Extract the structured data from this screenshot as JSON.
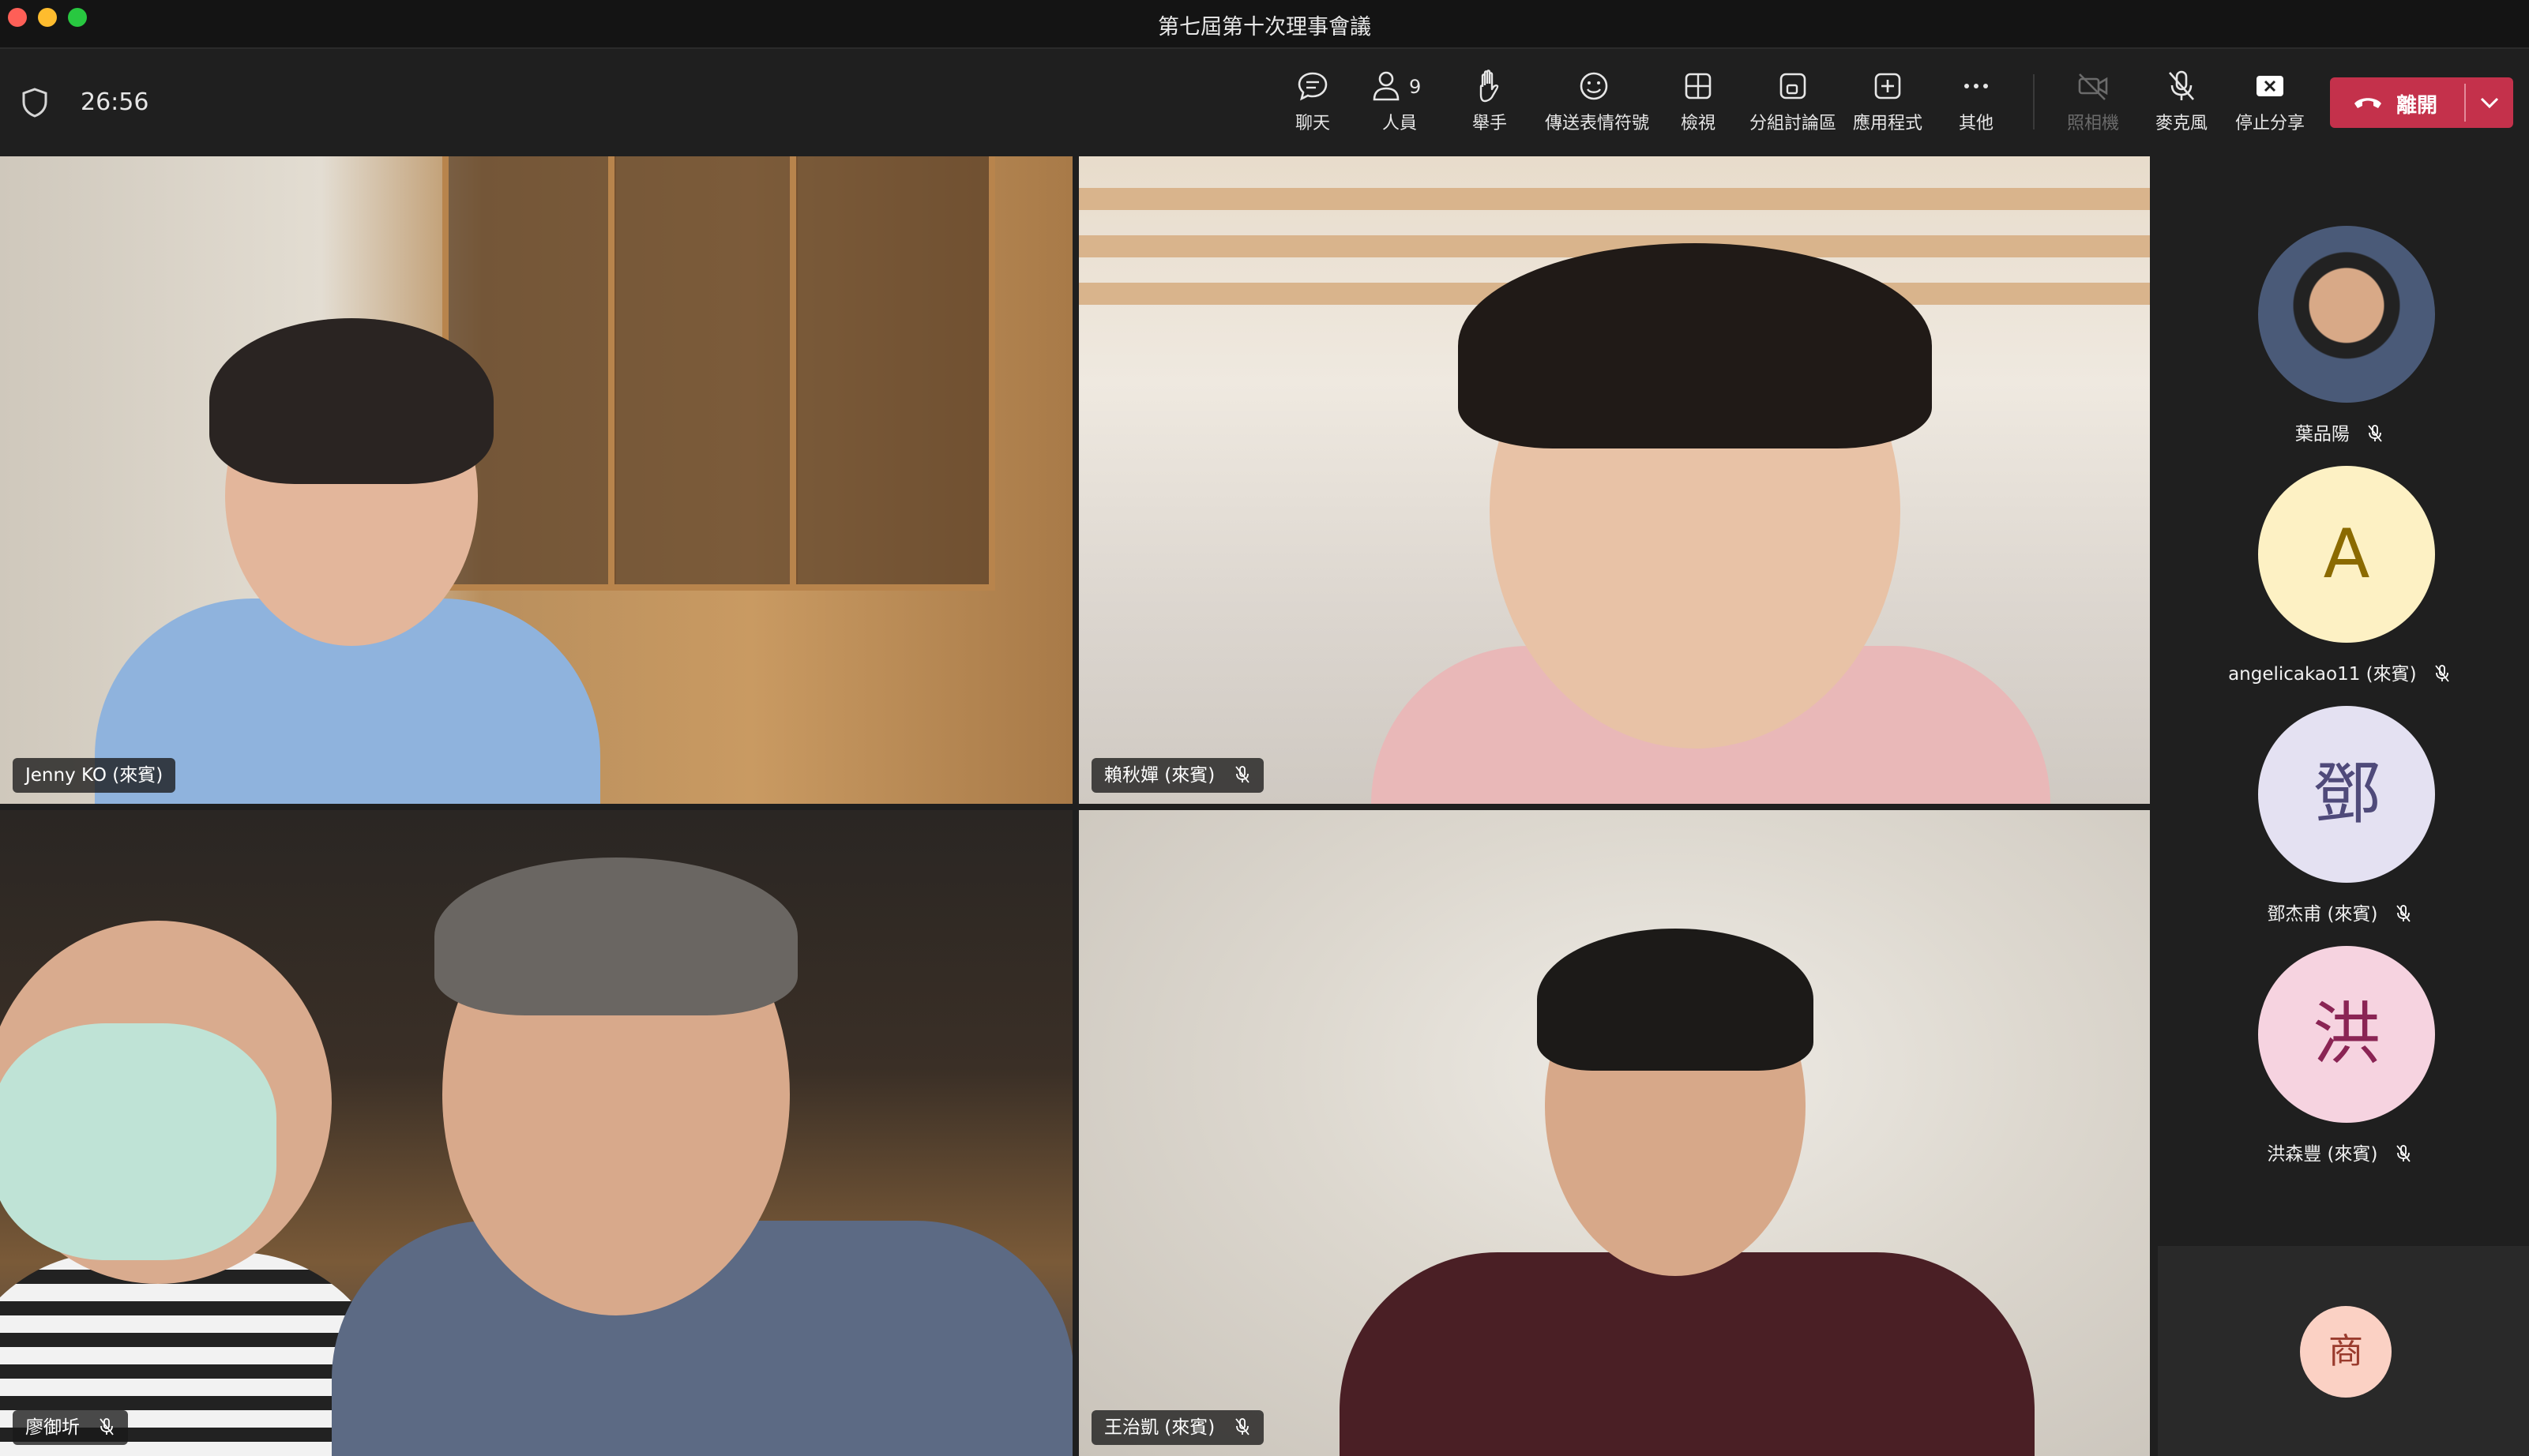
{
  "window": {
    "title": "第七屆第十次理事會議"
  },
  "meeting": {
    "elapsed": "26:56"
  },
  "toolbar": {
    "chat_label": "聊天",
    "people_label": "人員",
    "people_count": "9",
    "raise_hand_label": "舉手",
    "reactions_label": "傳送表情符號",
    "view_label": "檢視",
    "breakout_label": "分組討論區",
    "apps_label": "應用程式",
    "more_label": "其他",
    "camera_label": "照相機",
    "mic_label": "麥克風",
    "stop_share_label": "停止分享",
    "leave_label": "離開",
    "leave_color": "#c4314b"
  },
  "video_tiles": [
    {
      "name": "Jenny KO (來賓)",
      "muted": false
    },
    {
      "name": "賴秋嬋 (來賓)",
      "muted": true
    },
    {
      "name": "廖御圻",
      "muted": true
    },
    {
      "name": "王治凱 (來賓)",
      "muted": true
    }
  ],
  "sidebar": {
    "participants": [
      {
        "name": "葉品陽",
        "avatar": "photo",
        "muted": true
      },
      {
        "name": "angelicakao11 (來賓)",
        "initial": "A",
        "avatar_bg": "#fdf1c4",
        "avatar_fg": "#8b6a00",
        "muted": true
      },
      {
        "name": "鄧杰甫 (來賓)",
        "initial": "鄧",
        "avatar_bg": "#e4e1f2",
        "avatar_fg": "#4f4a7a",
        "muted": true
      },
      {
        "name": "洪森豐 (來賓)",
        "initial": "洪",
        "avatar_bg": "#f6d3e0",
        "avatar_fg": "#8a2454",
        "muted": true
      }
    ],
    "overflow": {
      "initial": "商"
    }
  }
}
